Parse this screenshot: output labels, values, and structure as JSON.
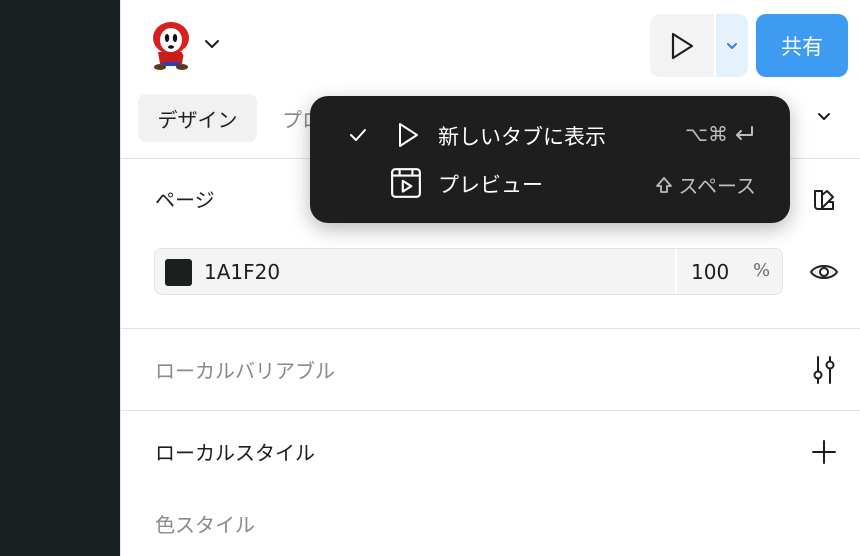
{
  "header": {
    "share_label": "共有"
  },
  "tabs": [
    {
      "label": "デザイン"
    },
    {
      "label": "プロ"
    }
  ],
  "page": {
    "title": "ページ",
    "background_hex": "1A1F20",
    "opacity": "100",
    "percent": "%"
  },
  "variables": {
    "label": "ローカルバリアブル"
  },
  "styles": {
    "title": "ローカルスタイル",
    "color_styles_label": "色スタイル"
  },
  "menu": {
    "items": [
      {
        "label": "新しいタブに表示",
        "checked": true,
        "icon": "play-icon",
        "shortcut": "⌥⌘"
      },
      {
        "label": "プレビュー",
        "checked": false,
        "icon": "preview-icon",
        "shortcut": "スペース"
      }
    ]
  },
  "colors": {
    "accent": "#3d9bf2",
    "menu_bg": "#1e1e1e",
    "canvas": "#1b2023"
  }
}
